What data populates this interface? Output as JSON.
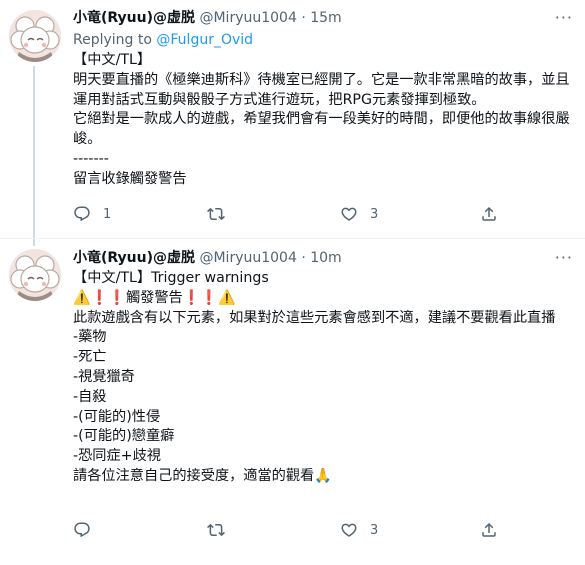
{
  "tweets": [
    {
      "name": "小竜(Ryuu)@虚脱",
      "handle": "@Miryuu1004",
      "dot": "·",
      "time": "15m",
      "replying_prefix": "Replying to ",
      "replying_to": "@Fulgur_Ovid",
      "body": "【中文/TL】\n明天要直播的《極樂迪斯科》待機室已經開了。它是一款非常黑暗的故事，並且運用對話式互動與骰骰子方式進行遊玩，把RPG元素發揮到極致。\n它絕對是一款成人的遊戲，希望我們會有一段美好的時間，即便他的故事線很嚴峻。\n-------\n留言收錄觸發警告",
      "reply_count": "1",
      "retweet_count": "",
      "like_count": "3"
    },
    {
      "name": "小竜(Ryuu)@虚脱",
      "handle": "@Miryuu1004",
      "dot": "·",
      "time": "10m",
      "body": "【中文/TL】Trigger warnings\n⚠️❗❗觸發警告❗❗⚠️\n此款遊戲含有以下元素，如果對於這些元素會感到不適，建議不要觀看此直播\n-藥物\n-死亡\n-視覺獵奇\n-自殺\n-(可能的)性侵\n-(可能的)戀童癖\n-恐同症+歧視\n請各位注意自己的接受度，適當的觀看🙏",
      "reply_count": "",
      "retweet_count": "",
      "like_count": "3"
    }
  ],
  "more_label": "···",
  "colors": {
    "text": "#0f1419",
    "secondary": "#536471",
    "link": "#1d9bf0",
    "divider": "#eff3f4",
    "thread_line": "#cfd9de"
  }
}
